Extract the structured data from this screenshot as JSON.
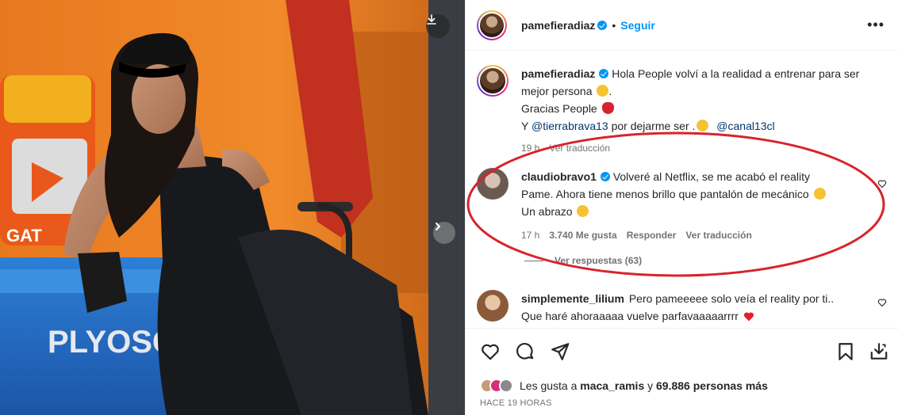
{
  "header": {
    "username": "pamefieradiaz",
    "follow_label": "Seguir",
    "more_label": "•••"
  },
  "caption": {
    "username": "pamefieradiaz",
    "line1": "Hola People volví a la realidad a entrenar para ser mejor persona",
    "line2": "Gracias People",
    "line3_prefix": "Y",
    "mention1": "@tierrabrava13",
    "line3_mid": "por dejarme ser .",
    "mention2": "@canal13cl",
    "time": "19 h",
    "translate_label": "Ver traducción"
  },
  "comments": [
    {
      "username": "claudiobravo1",
      "text_line1": "Volveré al Netflix, se me acabó el reality",
      "text_line2": "Pame. Ahora tiene menos brillo que pantalón de mecánico",
      "text_line3": "Un abrazo",
      "time": "17 h",
      "likes": "3.740 Me gusta",
      "reply_label": "Responder",
      "translate_label": "Ver traducción",
      "view_replies": "Ver respuestas (63)"
    },
    {
      "username": "simplemente_lilium",
      "text_line1": "Pero pameeeee solo veía el reality por ti..",
      "text_line2": "Que haré ahoraaaaa vuelve parfavaaaaarrrr"
    }
  ],
  "likes": {
    "prefix": "Les gusta a",
    "user": "maca_ramis",
    "joiner": "y",
    "others": "69.886 personas más"
  },
  "time_ago": "HACE 19 HORAS",
  "media": {
    "banner_text": "PLYOSO",
    "bottle_text": "GAT"
  },
  "colors": {
    "accent": "#0095f6",
    "annotation": "#d9232b",
    "heart_red": "#e0202c"
  }
}
